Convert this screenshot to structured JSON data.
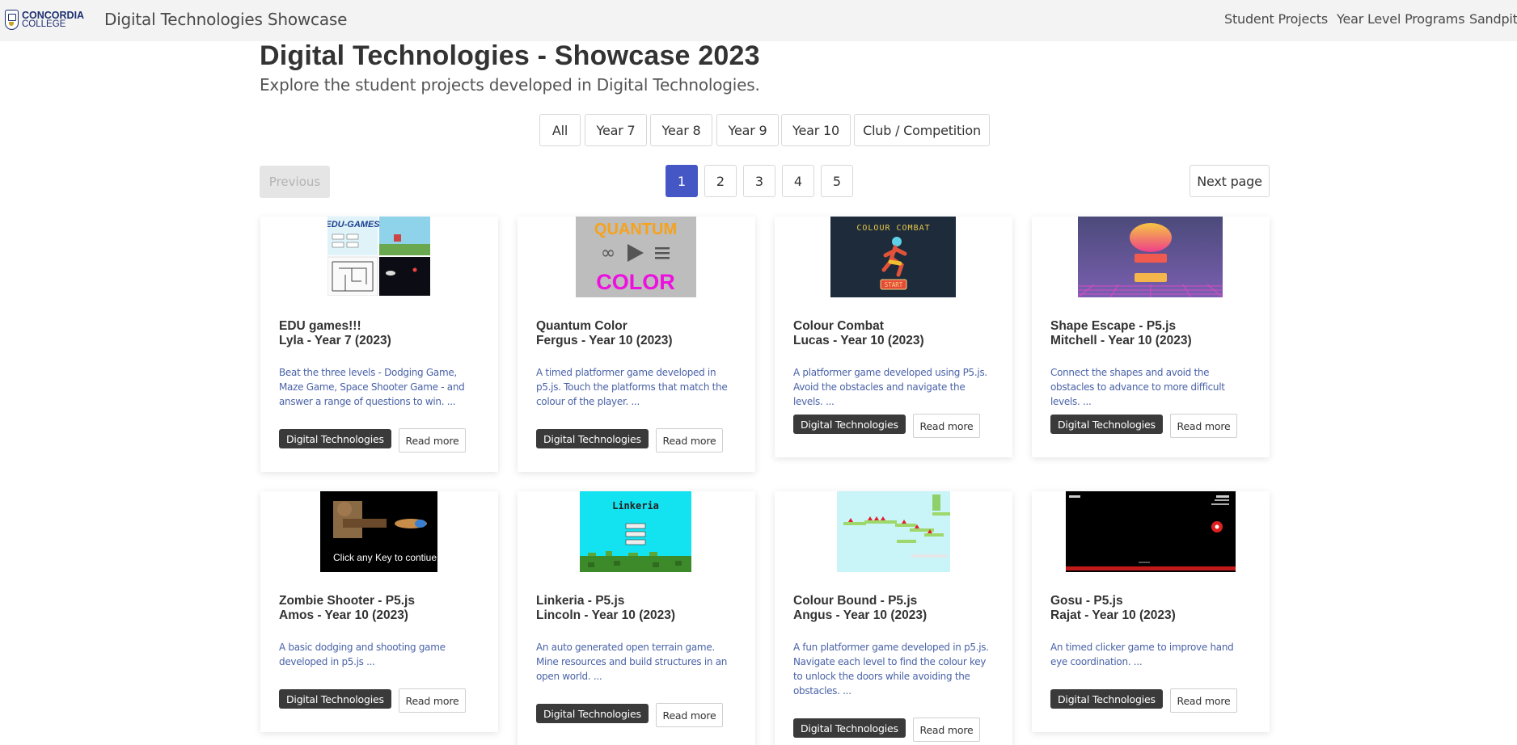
{
  "navbar": {
    "brand_line1": "CONCORDIA",
    "brand_line2": "COLLEGE",
    "title": "Digital Technologies Showcase",
    "links": [
      "Student Projects",
      "Year Level Programs",
      "Sandpit"
    ]
  },
  "header": {
    "title": "Digital Technologies - Showcase 2023",
    "subtitle": "Explore the student projects developed in Digital Technologies."
  },
  "filters": [
    "All",
    "Year 7",
    "Year 8",
    "Year 9",
    "Year 10",
    "Club / Competition"
  ],
  "pagination": {
    "previous_label": "Previous",
    "pages": [
      "1",
      "2",
      "3",
      "4",
      "5"
    ],
    "active_page": "1",
    "next_label": "Next page"
  },
  "cards": [
    {
      "title": "EDU games!!!",
      "author": "Lyla - Year 7 (2023)",
      "description": "Beat the three levels - Dodging Game, Maze Game, Space Shooter Game - and answer a range of questions to win. ...",
      "tag": "Digital Technologies",
      "button": "Read more",
      "thumb_text": "EDU-GAMES"
    },
    {
      "title": "Quantum Color",
      "author": "Fergus - Year 10 (2023)",
      "description": "A timed platformer game developed in p5.js. Touch the platforms that match the colour of the player. ...",
      "tag": "Digital Technologies",
      "button": "Read more",
      "thumb_text_top": "QUANTUM",
      "thumb_text_bottom": "COLOR"
    },
    {
      "title": "Colour Combat",
      "author": "Lucas - Year 10 (2023)",
      "description": "A platformer game developed using P5.js. Avoid the obstacles and navigate the levels. ...",
      "tag": "Digital Technologies",
      "button": "Read more",
      "thumb_text": "COLOUR COMBAT",
      "thumb_button": "START"
    },
    {
      "title": "Shape Escape - P5.js",
      "author": "Mitchell - Year 10 (2023)",
      "description": "Connect the shapes and avoid the obstacles to advance to more difficult levels. ...",
      "tag": "Digital Technologies",
      "button": "Read more"
    },
    {
      "title": "Zombie Shooter - P5.js",
      "author": "Amos - Year 10 (2023)",
      "description": "A basic dodging and shooting game developed in p5.js ...",
      "tag": "Digital Technologies",
      "button": "Read more",
      "thumb_text": "Click any Key to contiue"
    },
    {
      "title": "Linkeria - P5.js",
      "author": "Lincoln - Year 10 (2023)",
      "description": "An auto generated open terrain game. Mine resources and build structures in an open world. ...",
      "tag": "Digital Technologies",
      "button": "Read more",
      "thumb_text": "Linkeria"
    },
    {
      "title": "Colour Bound - P5.js",
      "author": "Angus - Year 10 (2023)",
      "description": "A fun platformer game developed in p5.js. Navigate each level to find the colour key to unlock the doors while avoiding the obstacles. ...",
      "tag": "Digital Technologies",
      "button": "Read more"
    },
    {
      "title": "Gosu - P5.js",
      "author": "Rajat - Year 10 (2023)",
      "description": "An timed clicker game to improve hand eye coordination. ...",
      "tag": "Digital Technologies",
      "button": "Read more"
    }
  ],
  "colors": {
    "accent": "#4557c4",
    "tag_bg": "#3a3a3a",
    "description": "#4a63a8",
    "navbar_bg": "#f3f3f3"
  }
}
